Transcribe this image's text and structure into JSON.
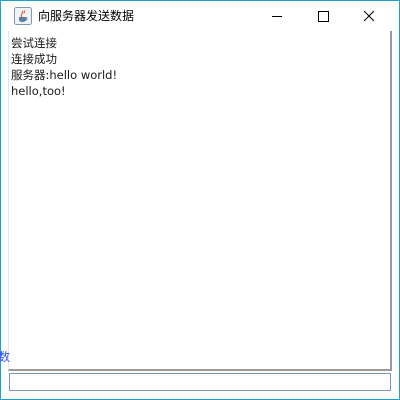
{
  "window": {
    "title": "向服务器发送数据"
  },
  "messages": [
    "尝试连接",
    "连接成功",
    "服务器:hello world!",
    "hello,too!"
  ],
  "left_stub_text": "数",
  "input": {
    "value": "",
    "placeholder": ""
  },
  "colors": {
    "window_border": "#1aa3c8",
    "text": "#1a1a1a",
    "input_border": "#7a9ab4"
  }
}
